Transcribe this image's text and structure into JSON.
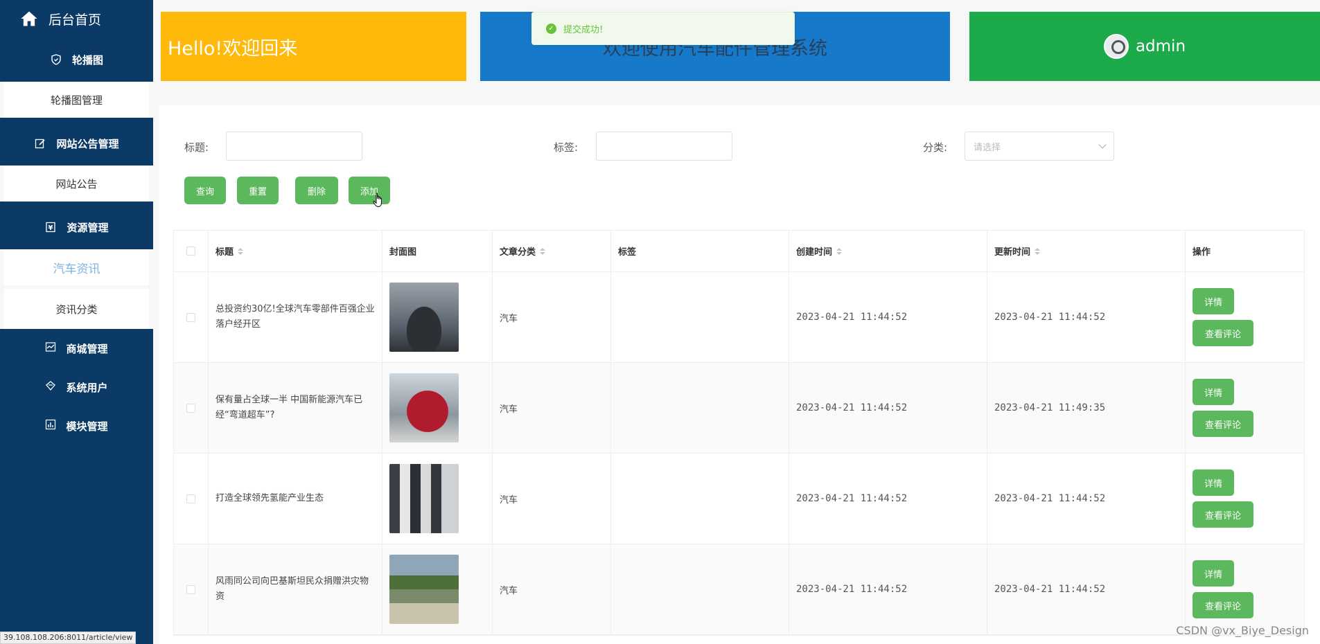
{
  "sidebar": {
    "home_label": "后台首页",
    "groups": [
      {
        "label": "轮播图",
        "icon": "shield-icon",
        "subs": [
          {
            "label": "轮播图管理",
            "active": false
          }
        ]
      },
      {
        "label": "网站公告管理",
        "icon": "edit-icon",
        "subs": [
          {
            "label": "网站公告",
            "active": false
          }
        ]
      },
      {
        "label": "资源管理",
        "icon": "yuan-icon",
        "subs": [
          {
            "label": "汽车资讯",
            "active": true
          },
          {
            "label": "资讯分类",
            "active": false
          }
        ]
      }
    ],
    "plain_items": [
      {
        "label": "商城管理",
        "icon": "chart-icon"
      },
      {
        "label": "系统用户",
        "icon": "diamond-icon"
      },
      {
        "label": "模块管理",
        "icon": "bar-chart-icon"
      }
    ]
  },
  "cards": {
    "welcome": "Hello!欢迎回来",
    "system": "欢迎使用汽车配件管理系统",
    "user": "admin"
  },
  "toast": {
    "message": "提交成功!"
  },
  "search": {
    "title_label": "标题:",
    "tag_label": "标签:",
    "category_label": "分类:",
    "category_placeholder": "请选择"
  },
  "buttons": {
    "query": "查询",
    "reset": "重置",
    "delete": "删除",
    "add": "添加"
  },
  "table": {
    "headers": [
      "标题",
      "封面图",
      "文章分类",
      "标签",
      "创建时间",
      "更新时间",
      "操作"
    ],
    "rows": [
      {
        "title": "总投资约30亿!全球汽车零部件百强企业落户经开区",
        "category": "汽车",
        "tag": "",
        "created": "2023-04-21 11:44:52",
        "updated": "2023-04-21 11:44:52"
      },
      {
        "title": "保有量占全球一半 中国新能源汽车已经“弯道超车”?",
        "category": "汽车",
        "tag": "",
        "created": "2023-04-21 11:44:52",
        "updated": "2023-04-21 11:49:35"
      },
      {
        "title": "打造全球领先氢能产业生态",
        "category": "汽车",
        "tag": "",
        "created": "2023-04-21 11:44:52",
        "updated": "2023-04-21 11:44:52"
      },
      {
        "title": "风雨同公司向巴基斯坦民众捐赠洪灾物资",
        "category": "汽车",
        "tag": "",
        "created": "2023-04-21 11:44:52",
        "updated": "2023-04-21 11:44:52"
      }
    ],
    "detail_label": "详情",
    "comment_label": "查看评论"
  },
  "status_url": "39.108.108.206:8011/article/view",
  "watermark": "CSDN @vx_Biye_Design",
  "colors": {
    "sidebar": "#0b3a66",
    "yellow": "#ffb90a",
    "blue": "#1779c9",
    "green": "#1caa4b",
    "button": "#5cb85c"
  }
}
